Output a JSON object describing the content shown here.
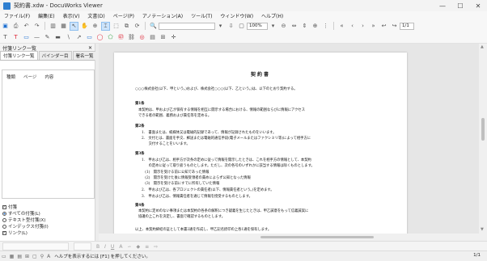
{
  "window": {
    "title": "契約書.xdw - DocuWorks Viewer",
    "controls": {
      "minimize": "—",
      "maximize": "☐",
      "close": "✕"
    }
  },
  "menu": [
    "ファイル(F)",
    "編集(E)",
    "表示(V)",
    "文書(D)",
    "ページ(P)",
    "アノテーション(A)",
    "ツール(T)",
    "ウィンドウ(W)",
    "ヘルプ(H)"
  ],
  "toolbar": {
    "zoom_value": "100%",
    "page_indicator": "1/1"
  },
  "panel": {
    "title": "付箋リンク一覧",
    "close": "✕",
    "tabs": [
      "付箋リンク一覧",
      "バインダー目",
      "署名一覧"
    ],
    "columns": [
      "種類",
      "ページ",
      "内容"
    ],
    "options": [
      {
        "kind": "check",
        "label": "付箋",
        "checked": true
      },
      {
        "kind": "radio",
        "label": "すべての付箋(L)",
        "checked": true
      },
      {
        "kind": "radio",
        "label": "テキスト型付箋(X)",
        "checked": false
      },
      {
        "kind": "radio",
        "label": "インデックス付箋(I)",
        "checked": false
      },
      {
        "kind": "check",
        "label": "リンク(L)",
        "checked": true
      }
    ]
  },
  "document": {
    "title": "契約書",
    "lines": [
      "○○○株式会社(以下、甲という。)および、株式会社○○○(以下、乙という。)は、以下のとおり契約する。",
      "第1条",
      "本契約は、甲および乙が保有する情報を相互に開示する場合における、情報の範囲ならびに情報にアクセス",
      "できる者の範囲、義務および責任等を定める。",
      "第2条",
      "1.　書面または、紙媒体又は電磁的記録であって、情報が記録されたものをいいます。",
      "2.　文付とは、書面を手交、郵送または電磁的通信手段(電子メールまたはファクシミリ等)によって相手方に",
      "　　交付することをいいます。",
      "第3条",
      "1.　甲および乙は、相手方が次条の定めに従って情報を開示したときは、これを相手方の情報として、本契約",
      "　　の定めに従って取り扱うものとします。ただし、次の各号のいずれかに該当する情報は除くものとします。",
      "　(1)　開示を受ける前に公知であった情報",
      "　(2)　開示を受けた後に情報受領者の責めによらず公知となった情報",
      "　(3)　開示を受ける前にすでに所有していた情報",
      "2.　甲および乙は、各プロジェクトの責任者(以下、情報責任者という。)を定めます。",
      "3.　甲および乙は、情報責任者を通じて情報を授受するものとします。",
      "第4条",
      "本契約に定めのない事項または本契約の各条の解釈につき疑義を生じたときは、甲乙誠意をもって信義誠実に",
      "協議の上これを決定し、書面で確認するものとします。",
      "以上、本契約締結の証として本書2通を作成し、甲乙記名捺印の上各1通を保有します。"
    ]
  },
  "status": {
    "help": "ヘルプを表示するには [F1] を押してください。",
    "page": "1/1"
  }
}
